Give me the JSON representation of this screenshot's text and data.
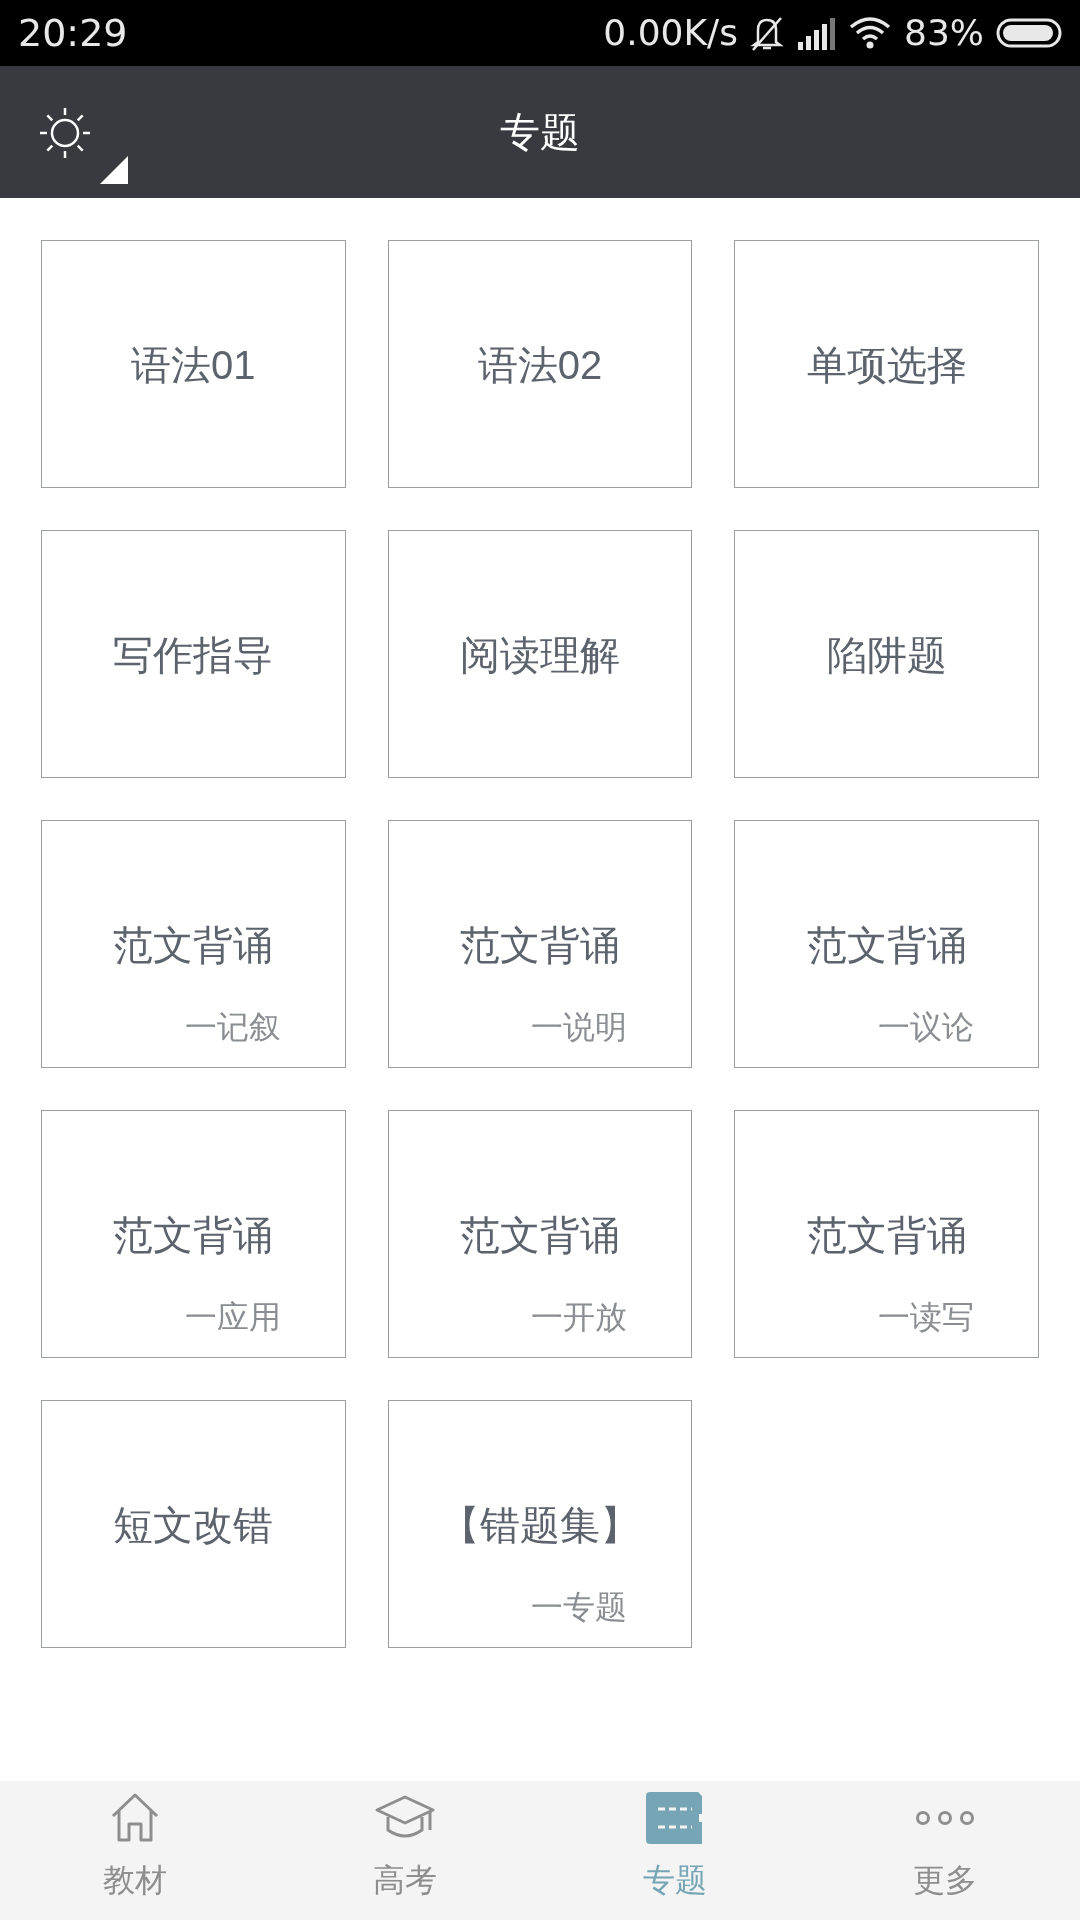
{
  "status_bar": {
    "time": "20:29",
    "network_speed": "0.00K/s",
    "battery": "83%"
  },
  "header": {
    "title": "专题"
  },
  "topics": [
    {
      "title": "语法01"
    },
    {
      "title": "语法02"
    },
    {
      "title": "单项选择"
    },
    {
      "title": "写作指导"
    },
    {
      "title": "阅读理解"
    },
    {
      "title": "陷阱题"
    },
    {
      "title": "范文背诵",
      "subtitle": "一记叙"
    },
    {
      "title": "范文背诵",
      "subtitle": "一说明"
    },
    {
      "title": "范文背诵",
      "subtitle": "一议论"
    },
    {
      "title": "范文背诵",
      "subtitle": "一应用"
    },
    {
      "title": "范文背诵",
      "subtitle": "一开放"
    },
    {
      "title": "范文背诵",
      "subtitle": "一读写"
    },
    {
      "title": "短文改错"
    },
    {
      "title": "【错题集】",
      "subtitle": "一专题"
    }
  ],
  "bottom_nav": [
    {
      "kind": "home",
      "label": "教材",
      "selected": false
    },
    {
      "kind": "cap",
      "label": "高考",
      "selected": false
    },
    {
      "kind": "topic",
      "label": "专题",
      "selected": true
    },
    {
      "kind": "more",
      "label": "更多",
      "selected": false
    }
  ]
}
